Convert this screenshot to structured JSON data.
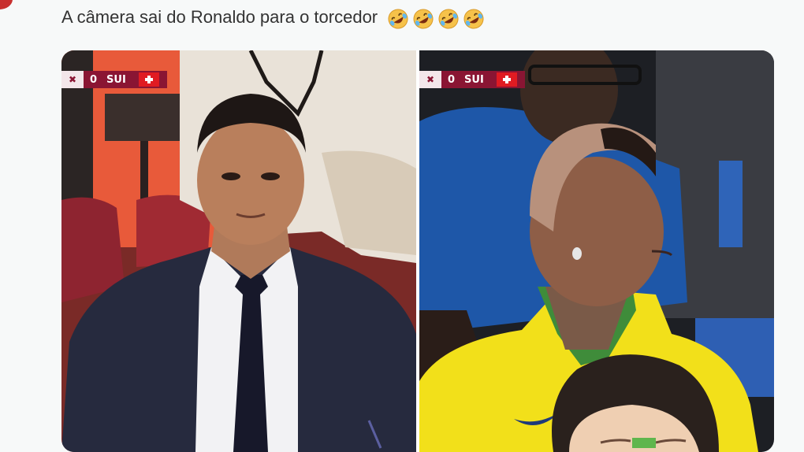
{
  "post": {
    "text": "A câmera sai do Ronaldo para o torcedor",
    "emojis": [
      "rolling-on-floor-laughing",
      "rolling-on-floor-laughing",
      "rolling-on-floor-laughing",
      "rolling-on-floor-laughing"
    ]
  },
  "photos": [
    {
      "scorebug": {
        "score": "0",
        "team": "SUI"
      }
    },
    {
      "scorebug": {
        "score": "0",
        "team": "SUI"
      }
    }
  ]
}
